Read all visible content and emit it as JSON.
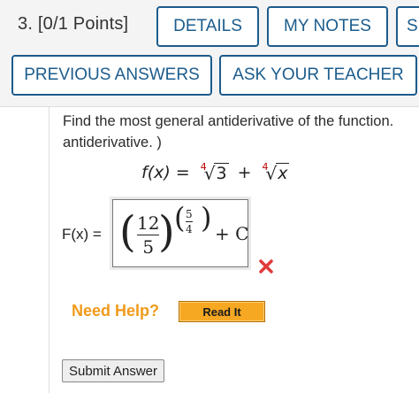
{
  "question": {
    "number": "3.",
    "points": "[0/1 Points]"
  },
  "buttons": {
    "details": "DETAILS",
    "my_notes": "MY NOTES",
    "share_partial": "S",
    "previous_answers": "PREVIOUS ANSWERS",
    "ask_teacher": "ASK YOUR TEACHER"
  },
  "problem": {
    "line1": "Find the most general antiderivative of the function.",
    "line2": "antiderivative. )",
    "f_label": "f(x) =",
    "root1_index": "4",
    "root1_radicand": "3",
    "plus": "+",
    "root2_index": "4",
    "root2_radicand": "x"
  },
  "answer": {
    "label": "F(x) =",
    "main_num": "12",
    "main_den": "5",
    "exp_num": "5",
    "exp_den": "4",
    "tail": "+ C",
    "status": "incorrect"
  },
  "help": {
    "need_help": "Need Help?",
    "read_it": "Read It"
  },
  "submit_label": "Submit Answer",
  "colors": {
    "header_border": "#1c5c8c",
    "need_help": "#f09a1a",
    "read_it_bg": "#f7a823",
    "incorrect_mark": "#e03a3a",
    "root_index_red": "#c00000"
  }
}
